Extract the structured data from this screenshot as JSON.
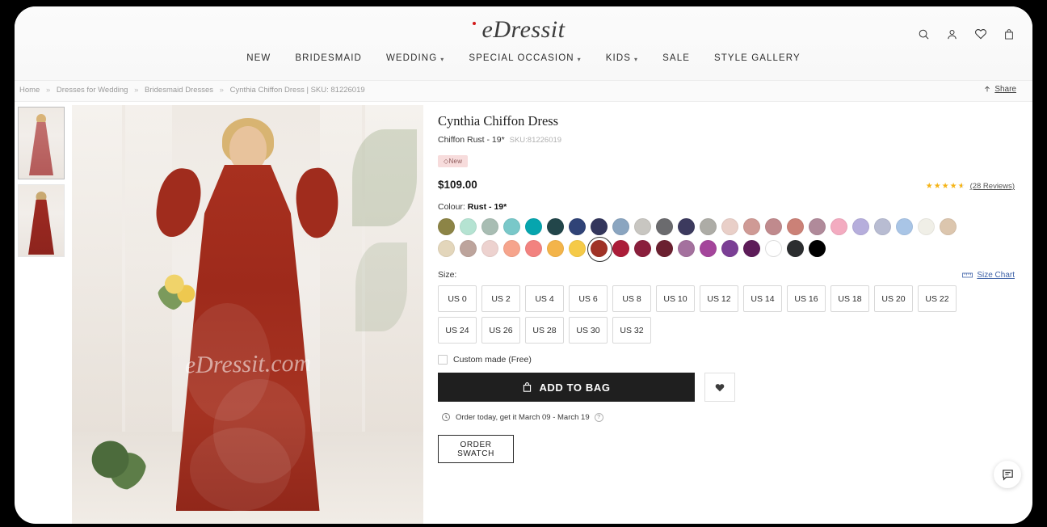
{
  "header": {
    "logo_text": "eDressit",
    "nav": [
      {
        "label": "NEW",
        "has_caret": false
      },
      {
        "label": "BRIDESMAID",
        "has_caret": false
      },
      {
        "label": "WEDDING",
        "has_caret": true
      },
      {
        "label": "SPECIAL OCCASION",
        "has_caret": true
      },
      {
        "label": "KIDS",
        "has_caret": true
      },
      {
        "label": "SALE",
        "has_caret": false
      },
      {
        "label": "STYLE GALLERY",
        "has_caret": false
      }
    ],
    "icons": [
      "search-icon",
      "account-icon",
      "wishlist-icon",
      "bag-icon"
    ]
  },
  "breadcrumb": {
    "items": [
      "Home",
      "Dresses for Wedding",
      "Bridesmaid Dresses",
      "Cynthia Chiffon Dress | SKU:  81226019"
    ],
    "separator": "»",
    "share_label": "Share"
  },
  "product": {
    "title": "Cynthia Chiffon Dress",
    "subtitle": "Chiffon Rust - 19*",
    "sku": "SKU:81226019",
    "badge": "New",
    "price": "$109.00",
    "rating_value": 4.5,
    "reviews_label": "(28 Reviews)",
    "watermark": "eDressit.com"
  },
  "colour": {
    "label": "Colour:",
    "selected": "Rust - 19*",
    "swatches": [
      {
        "name": "olive",
        "hex": "#8c8446"
      },
      {
        "name": "mint-pale",
        "hex": "#b5e3d2"
      },
      {
        "name": "sage-grey",
        "hex": "#a8bdb3"
      },
      {
        "name": "aqua",
        "hex": "#79c8c9"
      },
      {
        "name": "teal-bright",
        "hex": "#06a5ae"
      },
      {
        "name": "dark-teal",
        "hex": "#22464a"
      },
      {
        "name": "royal-navy",
        "hex": "#304377"
      },
      {
        "name": "navy-dark",
        "hex": "#33365c"
      },
      {
        "name": "steel-blue",
        "hex": "#8aa5c0"
      },
      {
        "name": "light-grey",
        "hex": "#c8c6c1"
      },
      {
        "name": "charcoal-grey",
        "hex": "#6b6b6e"
      },
      {
        "name": "indigo-slate",
        "hex": "#3c3a5e"
      },
      {
        "name": "warm-grey",
        "hex": "#adaca6"
      },
      {
        "name": "blush-pale",
        "hex": "#e9cfc8"
      },
      {
        "name": "rose-dust",
        "hex": "#cf9a95"
      },
      {
        "name": "mauve-rose",
        "hex": "#c08a8d"
      },
      {
        "name": "terracotta-pink",
        "hex": "#cb8177"
      },
      {
        "name": "dusty-mauve",
        "hex": "#b08a9a"
      },
      {
        "name": "pink",
        "hex": "#f3abc0"
      },
      {
        "name": "lilac",
        "hex": "#b6aedc"
      },
      {
        "name": "periwinkle-grey",
        "hex": "#b8bcd2"
      },
      {
        "name": "sky-blue",
        "hex": "#a9c5e6"
      },
      {
        "name": "ivory",
        "hex": "#f0efe7"
      },
      {
        "name": "champagne",
        "hex": "#dcc6ae"
      },
      {
        "name": "cream-beige",
        "hex": "#e3d6bb"
      },
      {
        "name": "taupe",
        "hex": "#bda49c"
      },
      {
        "name": "pink-pale",
        "hex": "#edd2cf"
      },
      {
        "name": "coral-light",
        "hex": "#f6a48c"
      },
      {
        "name": "coral",
        "hex": "#f2827f"
      },
      {
        "name": "marigold",
        "hex": "#f3b košík"
      },
      {
        "name": "yellow",
        "hex": "#f5ca48"
      },
      {
        "name": "rust-19",
        "hex": "#a03226"
      },
      {
        "name": "cranberry",
        "hex": "#ab1c38"
      },
      {
        "name": "burgundy",
        "hex": "#8a1f3c"
      },
      {
        "name": "wine-dark",
        "hex": "#6b2030"
      },
      {
        "name": "orchid-dusty",
        "hex": "#a4719e"
      },
      {
        "name": "magenta-purple",
        "hex": "#a4459b"
      },
      {
        "name": "purple",
        "hex": "#7b3f95"
      },
      {
        "name": "deep-purple",
        "hex": "#5d1c59"
      },
      {
        "name": "white",
        "hex": "#ffffff"
      },
      {
        "name": "charcoal",
        "hex": "#2b2d2f"
      },
      {
        "name": "black",
        "hex": "#000000"
      }
    ],
    "selected_index": 31
  },
  "size": {
    "label": "Size:",
    "chart_label": "Size Chart",
    "options": [
      "US 0",
      "US 2",
      "US 4",
      "US 6",
      "US 8",
      "US 10",
      "US 12",
      "US 14",
      "US 16",
      "US 18",
      "US 20",
      "US 22",
      "US 24",
      "US 26",
      "US 28",
      "US 30",
      "US 32"
    ]
  },
  "custom_made": {
    "label": "Custom made (Free)",
    "checked": false
  },
  "actions": {
    "add_to_bag": "ADD TO BAG",
    "order_swatch": "ORDER SWATCH",
    "eta": "Order today, get it March 09 - March 19",
    "help_glyph": "?"
  },
  "gallery": {
    "thumbs": [
      {
        "name": "thumb-front",
        "selected": true
      },
      {
        "name": "thumb-back",
        "selected": false
      }
    ]
  }
}
